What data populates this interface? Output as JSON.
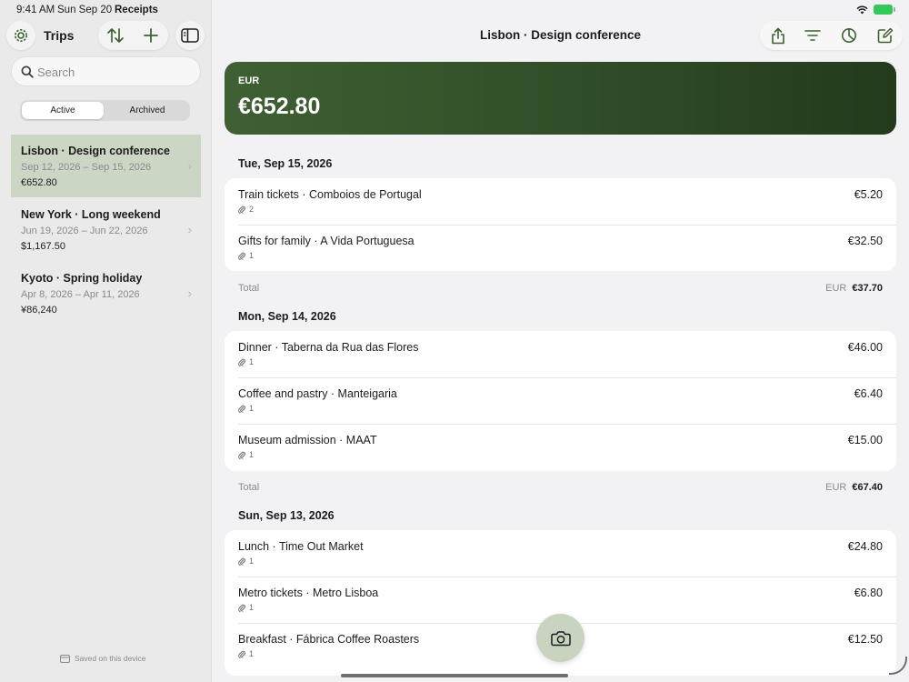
{
  "status_bar": {
    "time": "9:41 AM",
    "date": "Sun Sep 20",
    "app": "Receipts"
  },
  "sidebar": {
    "title": "Trips",
    "search_placeholder": "Search",
    "segments": [
      "Active",
      "Archived"
    ],
    "selected_segment": "Active",
    "trips": [
      {
        "name": "Lisbon · Design conference",
        "dates": "Sep 12, 2026 – Sep 15, 2026",
        "total": "€652.80",
        "selected": true
      },
      {
        "name": "New York · Long weekend",
        "dates": "Jun 19, 2026 – Jun 22, 2026",
        "total": "$1,167.50",
        "selected": false
      },
      {
        "name": "Kyoto · Spring holiday",
        "dates": "Apr 8, 2026 – Apr 11, 2026",
        "total": "¥86,240",
        "selected": false
      }
    ],
    "saved_note": "Saved on this device"
  },
  "main": {
    "title": "Lisbon · Design conference",
    "banner": {
      "currency": "EUR",
      "amount": "€652.80"
    },
    "days": [
      {
        "header": "Tue, Sep 15, 2026",
        "rows": [
          {
            "title": "Train tickets · Comboios de Portugal",
            "attachments": "2",
            "amount": "€5.20"
          },
          {
            "title": "Gifts for family · A Vida Portuguesa",
            "attachments": "1",
            "amount": "€32.50"
          }
        ],
        "total_label": "Total",
        "total_currency": "EUR",
        "total_value": "€37.70"
      },
      {
        "header": "Mon, Sep 14, 2026",
        "rows": [
          {
            "title": "Dinner · Taberna da Rua das Flores",
            "attachments": "1",
            "amount": "€46.00"
          },
          {
            "title": "Coffee and pastry · Manteigaria",
            "attachments": "1",
            "amount": "€6.40"
          },
          {
            "title": "Museum admission · MAAT",
            "attachments": "1",
            "amount": "€15.00"
          }
        ],
        "total_label": "Total",
        "total_currency": "EUR",
        "total_value": "€67.40"
      },
      {
        "header": "Sun, Sep 13, 2026",
        "rows": [
          {
            "title": "Lunch · Time Out Market",
            "attachments": "1",
            "amount": "€24.80"
          },
          {
            "title": "Metro tickets · Metro Lisboa",
            "attachments": "1",
            "amount": "€6.80"
          },
          {
            "title": "Breakfast · Fábrica Coffee Roasters",
            "attachments": "1",
            "amount": "€12.50"
          }
        ]
      }
    ]
  },
  "colors": {
    "accent": "#3e6033",
    "selected_trip": "#ccd6c4",
    "banner_dark": "#243a1c",
    "fab": "#c9d4c0"
  },
  "icons": [
    "gear-icon",
    "sort-icon",
    "plus-icon",
    "sidebar-toggle-icon",
    "search-icon",
    "chevron-right-icon",
    "share-icon",
    "filter-icon",
    "chart-icon",
    "compose-icon",
    "paperclip-icon",
    "camera-icon",
    "device-icon"
  ]
}
